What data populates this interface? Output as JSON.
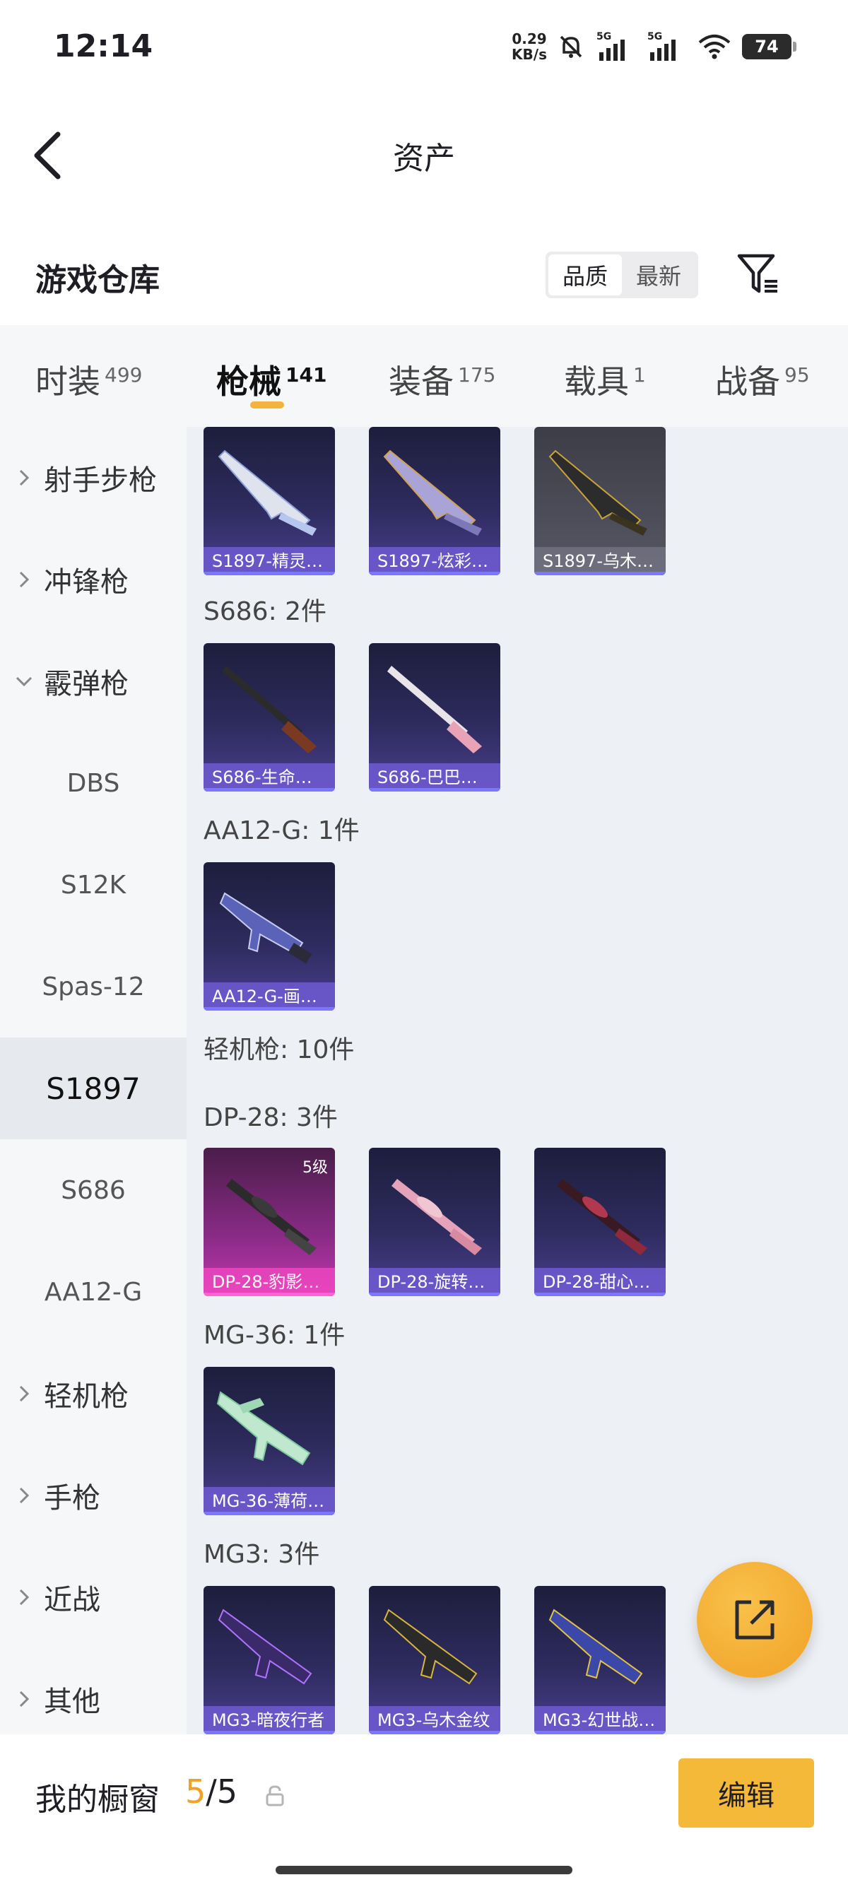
{
  "status_bar": {
    "time": "12:14",
    "net_speed_value": "0.29",
    "net_speed_unit": "KB/s",
    "network_1": "5G",
    "network_2": "5G",
    "battery": "74"
  },
  "header": {
    "title": "资产"
  },
  "section": {
    "title": "游戏仓库",
    "sort_options": [
      "品质",
      "最新"
    ],
    "active_sort": "品质"
  },
  "tabs": [
    {
      "label": "时装",
      "count": "499"
    },
    {
      "label": "枪械",
      "count": "141",
      "active": true
    },
    {
      "label": "装备",
      "count": "175"
    },
    {
      "label": "载具",
      "count": "1"
    },
    {
      "label": "战备",
      "count": "95"
    }
  ],
  "sidebar": {
    "items": [
      {
        "label": "射手步枪",
        "type": "category",
        "expanded": false
      },
      {
        "label": "冲锋枪",
        "type": "category",
        "expanded": false
      },
      {
        "label": "霰弹枪",
        "type": "category",
        "expanded": true
      },
      {
        "label": "DBS",
        "type": "sub"
      },
      {
        "label": "S12K",
        "type": "sub"
      },
      {
        "label": "Spas-12",
        "type": "sub"
      },
      {
        "label": "S1897",
        "type": "sub",
        "selected": true
      },
      {
        "label": "S686",
        "type": "sub"
      },
      {
        "label": "AA12-G",
        "type": "sub"
      },
      {
        "label": "轻机枪",
        "type": "category",
        "expanded": false
      },
      {
        "label": "手枪",
        "type": "category",
        "expanded": false
      },
      {
        "label": "近战",
        "type": "category",
        "expanded": false
      },
      {
        "label": "其他",
        "type": "category",
        "expanded": false
      }
    ]
  },
  "content": {
    "groups": [
      {
        "label": "",
        "items": [
          {
            "name": "S1897-精灵…",
            "style": "purple"
          },
          {
            "name": "S1897-炫彩…",
            "style": "purple"
          },
          {
            "name": "S1897-乌木…",
            "style": "grey"
          }
        ]
      },
      {
        "label": "S686: 2件",
        "items": [
          {
            "name": "S686-生命…",
            "style": "purple"
          },
          {
            "name": "S686-巴巴…",
            "style": "purple"
          }
        ]
      },
      {
        "label": "AA12-G: 1件",
        "items": [
          {
            "name": "AA12-G-画…",
            "style": "purple"
          }
        ]
      },
      {
        "label": "轻机枪: 10件",
        "items": []
      },
      {
        "label": "DP-28: 3件",
        "items": [
          {
            "name": "DP-28-豹影…",
            "style": "pink",
            "level": "5级"
          },
          {
            "name": "DP-28-旋转…",
            "style": "purple"
          },
          {
            "name": "DP-28-甜心…",
            "style": "purple"
          }
        ]
      },
      {
        "label": "MG-36: 1件",
        "items": [
          {
            "name": "MG-36-薄荷…",
            "style": "purple"
          }
        ]
      },
      {
        "label": "MG3: 3件",
        "items": [
          {
            "name": "MG3-暗夜行者",
            "style": "purple"
          },
          {
            "name": "MG3-乌木金纹",
            "style": "purple"
          },
          {
            "name": "MG3-幻世战…",
            "style": "purple"
          }
        ]
      }
    ]
  },
  "bottom": {
    "title": "我的橱窗",
    "current": "5",
    "separator": "/",
    "total": "5",
    "edit_label": "编辑"
  },
  "colors": {
    "accent": "#f4b33c",
    "card_purple": "#2e2b5e",
    "card_pink": "#c237b0"
  }
}
